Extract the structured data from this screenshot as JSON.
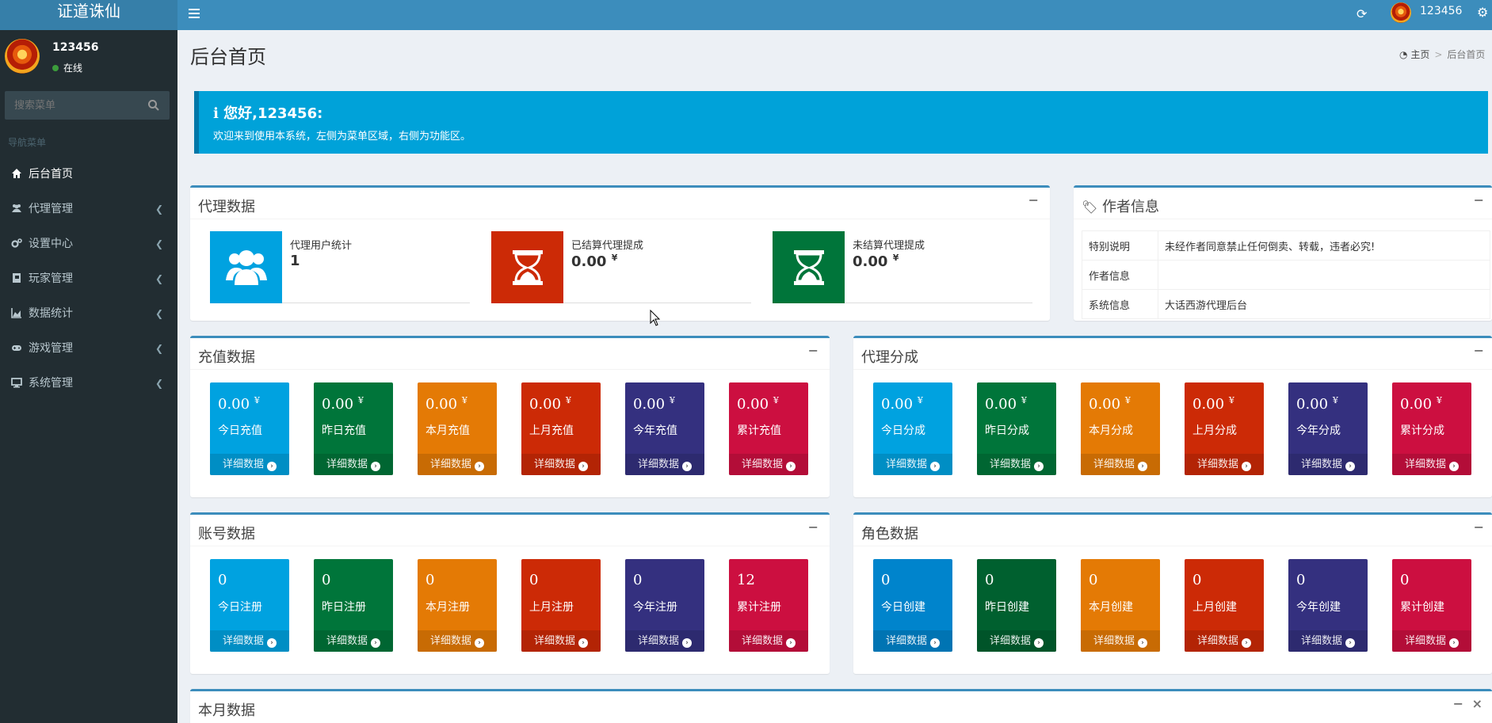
{
  "app": {
    "title": "证道诛仙"
  },
  "colors": {
    "aqua": "#00a2e0",
    "green": "#00753a",
    "orange": "#e47a05",
    "red": "#cc2a06",
    "purple": "#34307f",
    "maroon": "#cc0f40",
    "topbar": "#3c8dbc",
    "sidebar": "#222d32"
  },
  "user": {
    "name": "123456",
    "status": "在线"
  },
  "search": {
    "placeholder": "搜索菜单"
  },
  "nav": {
    "header": "导航菜单",
    "items": [
      {
        "label": "后台首页",
        "icon": "home-icon"
      },
      {
        "label": "代理管理",
        "icon": "users-icon"
      },
      {
        "label": "设置中心",
        "icon": "gears-icon"
      },
      {
        "label": "玩家管理",
        "icon": "book-icon"
      },
      {
        "label": "数据统计",
        "icon": "area-chart-icon"
      },
      {
        "label": "游戏管理",
        "icon": "gamepad-icon"
      },
      {
        "label": "系统管理",
        "icon": "desktop-icon"
      }
    ]
  },
  "topbar": {
    "username": "123456"
  },
  "page": {
    "title": "后台首页"
  },
  "breadcrumb": {
    "home": "主页",
    "current": "后台首页"
  },
  "callout": {
    "title": "您好,123456:",
    "text": "欢迎来到使用本系统，左侧为菜单区域，右侧为功能区。"
  },
  "agent_data": {
    "title": "代理数据",
    "items": [
      {
        "label": "代理用户统计",
        "value": "1",
        "unit": ""
      },
      {
        "label": "已结算代理提成",
        "value": "0.00",
        "unit": "¥"
      },
      {
        "label": "未结算代理提成",
        "value": "0.00",
        "unit": "¥"
      }
    ]
  },
  "author_info": {
    "title": "作者信息",
    "rows": [
      {
        "key": "特别说明",
        "value": "未经作者同意禁止任何倒卖、转载，违者必究!"
      },
      {
        "key": "作者信息",
        "value": ""
      },
      {
        "key": "系统信息",
        "value": "大话西游代理后台"
      }
    ]
  },
  "recharge_data": {
    "title": "充值数据",
    "items": [
      {
        "value": "0.00",
        "unit": "¥",
        "label": "今日充值",
        "link": "详细数据"
      },
      {
        "value": "0.00",
        "unit": "¥",
        "label": "昨日充值",
        "link": "详细数据"
      },
      {
        "value": "0.00",
        "unit": "¥",
        "label": "本月充值",
        "link": "详细数据"
      },
      {
        "value": "0.00",
        "unit": "¥",
        "label": "上月充值",
        "link": "详细数据"
      },
      {
        "value": "0.00",
        "unit": "¥",
        "label": "今年充值",
        "link": "详细数据"
      },
      {
        "value": "0.00",
        "unit": "¥",
        "label": "累计充值",
        "link": "详细数据"
      }
    ]
  },
  "agent_share": {
    "title": "代理分成",
    "items": [
      {
        "value": "0.00",
        "unit": "¥",
        "label": "今日分成",
        "link": "详细数据"
      },
      {
        "value": "0.00",
        "unit": "¥",
        "label": "昨日分成",
        "link": "详细数据"
      },
      {
        "value": "0.00",
        "unit": "¥",
        "label": "本月分成",
        "link": "详细数据"
      },
      {
        "value": "0.00",
        "unit": "¥",
        "label": "上月分成",
        "link": "详细数据"
      },
      {
        "value": "0.00",
        "unit": "¥",
        "label": "今年分成",
        "link": "详细数据"
      },
      {
        "value": "0.00",
        "unit": "¥",
        "label": "累计分成",
        "link": "详细数据"
      }
    ]
  },
  "account_data": {
    "title": "账号数据",
    "items": [
      {
        "value": "0",
        "label": "今日注册",
        "link": "详细数据"
      },
      {
        "value": "0",
        "label": "昨日注册",
        "link": "详细数据"
      },
      {
        "value": "0",
        "label": "本月注册",
        "link": "详细数据"
      },
      {
        "value": "0",
        "label": "上月注册",
        "link": "详细数据"
      },
      {
        "value": "0",
        "label": "今年注册",
        "link": "详细数据"
      },
      {
        "value": "12",
        "label": "累计注册",
        "link": "详细数据"
      }
    ]
  },
  "role_data": {
    "title": "角色数据",
    "items": [
      {
        "value": "0",
        "label": "今日创建",
        "link": "详细数据"
      },
      {
        "value": "0",
        "label": "昨日创建",
        "link": "详细数据"
      },
      {
        "value": "0",
        "label": "本月创建",
        "link": "详细数据"
      },
      {
        "value": "0",
        "label": "上月创建",
        "link": "详细数据"
      },
      {
        "value": "0",
        "label": "今年创建",
        "link": "详细数据"
      },
      {
        "value": "0",
        "label": "累计创建",
        "link": "详细数据"
      }
    ]
  },
  "month_data": {
    "title": "本月数据"
  }
}
